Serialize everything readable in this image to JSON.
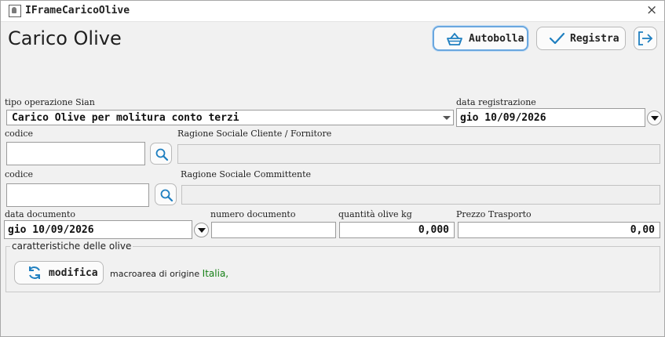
{
  "window": {
    "title": "IFrameCaricoOlive"
  },
  "header": {
    "title": "Carico Olive"
  },
  "toolbar": {
    "autobolla_label": "Autobolla",
    "registra_label": "Registra"
  },
  "tipo_operazione": {
    "label": "tipo operazione Sian",
    "value": "Carico Olive per molitura conto terzi"
  },
  "data_registrazione": {
    "label": "data registrazione",
    "value": "gio 10/09/2026"
  },
  "cliente": {
    "code_label": "codice",
    "code_value": "",
    "name_label": "Ragione Sociale Cliente / Fornitore",
    "name_value": ""
  },
  "committente": {
    "code_label": "codice",
    "code_value": "",
    "name_label": "Ragione Sociale Committente",
    "name_value": ""
  },
  "data_documento": {
    "label": "data documento",
    "value": "gio 10/09/2026"
  },
  "numero_documento": {
    "label": "numero documento",
    "value": ""
  },
  "quantita": {
    "label": "quantità olive kg",
    "value": "0,000"
  },
  "prezzo_trasporto": {
    "label": "Prezzo Trasporto",
    "value": "0,00"
  },
  "caratteristiche": {
    "legend": "caratteristiche delle olive",
    "modifica_label": "modifica",
    "macroarea_label": "macroarea di origine",
    "macroarea_value": "Italia",
    "macroarea_suffix": ","
  },
  "colors": {
    "accent": "#1f7fc0",
    "focus": "#6aa7df",
    "origin_text": "#168016"
  }
}
